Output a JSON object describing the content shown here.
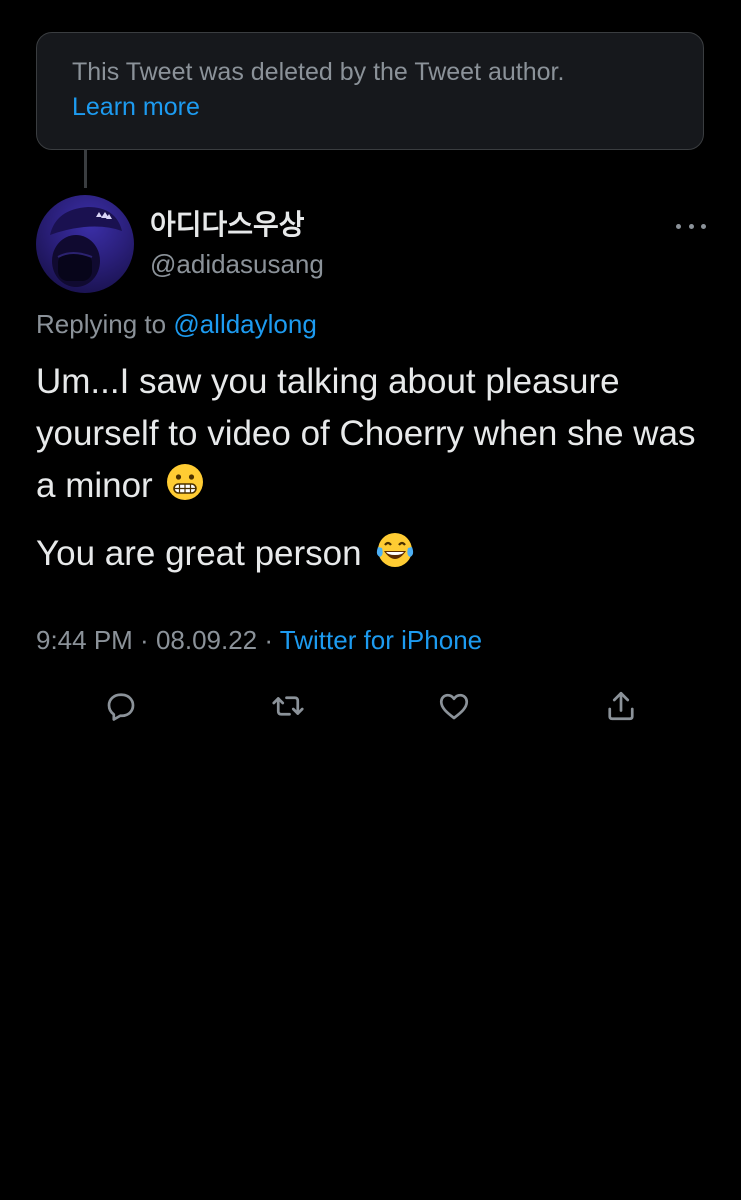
{
  "deleted_notice": {
    "text": "This Tweet was deleted by the Tweet author.",
    "link_label": "Learn more"
  },
  "tweet": {
    "display_name": "아디다스우상",
    "handle": "@adidasusang",
    "replying_prefix": "Replying to ",
    "replying_to": "@alldaylong",
    "paragraphs": [
      "Um...I saw you talking about pleasure yourself to video of Choerry when she was a minor",
      "You are great person"
    ],
    "time": "9:44 PM",
    "separator": " · ",
    "date": "08.09.22",
    "source": "Twitter for iPhone"
  },
  "colors": {
    "background": "#000000",
    "text": "#e7e9ea",
    "muted": "#8b9299",
    "accent": "#1d9bf0"
  },
  "icons": {
    "more": "more-icon",
    "reply": "reply-icon",
    "retweet": "retweet-icon",
    "like": "like-icon",
    "share": "share-icon",
    "emoji_grimace": "grimacing-face-emoji",
    "emoji_laugh": "tears-of-joy-emoji"
  }
}
